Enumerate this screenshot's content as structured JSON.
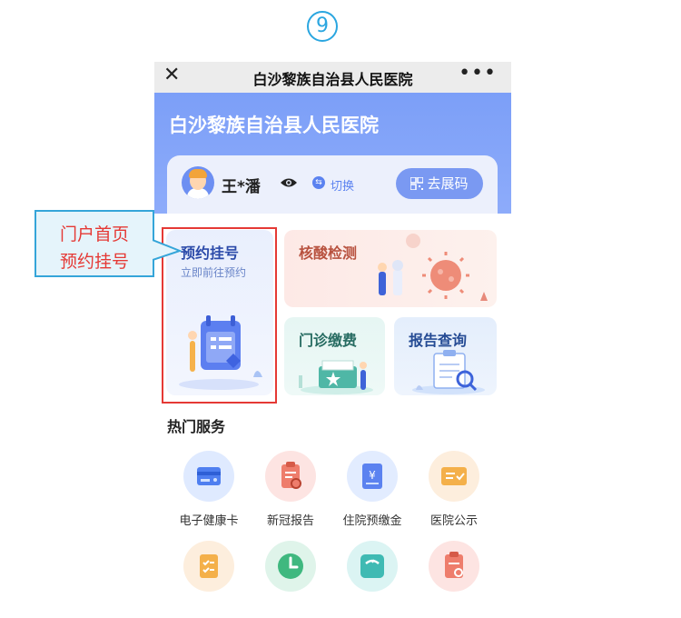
{
  "step_number": "9",
  "nav": {
    "close_symbol": "✕",
    "title": "白沙黎族自治县人民医院",
    "more_symbol": "•••"
  },
  "hero": {
    "hospital_name": "白沙黎族自治县人民医院"
  },
  "user_card": {
    "name": "王*潘",
    "switch_label": "切换",
    "qr_button_label": "去展码"
  },
  "tiles": {
    "appointment": {
      "title": "预约挂号",
      "subtitle": "立即前往预约"
    },
    "nucleic_test": {
      "title": "核酸检测"
    },
    "outpatient_payment": {
      "title": "门诊缴费"
    },
    "report_query": {
      "title": "报告查询"
    }
  },
  "hot_services": {
    "title": "热门服务",
    "row1": [
      {
        "label": "电子健康卡",
        "icon": "health-card-icon",
        "color": "#dfeaff"
      },
      {
        "label": "新冠报告",
        "icon": "covid-report-icon",
        "color": "#fde4e2"
      },
      {
        "label": "住院预缴金",
        "icon": "inpatient-deposit-icon",
        "color": "#e2ecff"
      },
      {
        "label": "医院公示",
        "icon": "hospital-notice-icon",
        "color": "#fdeedd"
      }
    ],
    "row2_icons": [
      {
        "icon": "checklist-icon",
        "color": "#fdeedd"
      },
      {
        "icon": "clock-icon",
        "color": "#dff4ea"
      },
      {
        "icon": "scale-icon",
        "color": "#dbf4f3"
      },
      {
        "icon": "clipboard-icon",
        "color": "#fde4e2"
      }
    ]
  },
  "annotation": {
    "line1": "门户首页",
    "line2": "预约挂号"
  }
}
